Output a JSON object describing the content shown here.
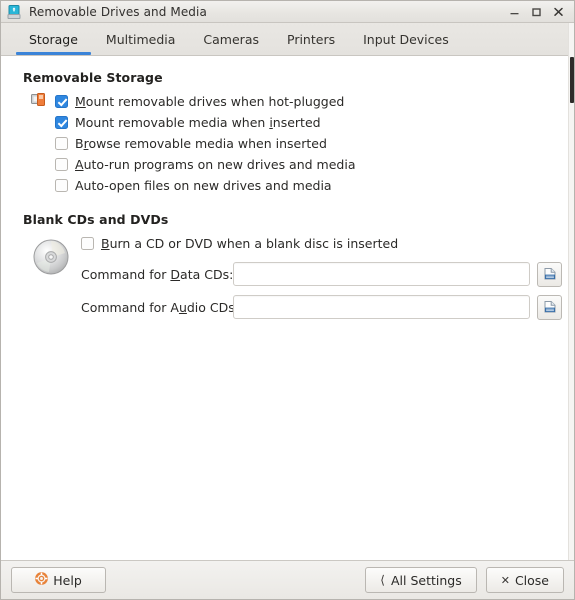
{
  "window": {
    "title": "Removable Drives and Media",
    "icon": "removable-drive-icon",
    "controls": {
      "minimize": "minimize-icon",
      "maximize": "maximize-icon",
      "close": "close-icon"
    }
  },
  "tabs": [
    {
      "label": "Storage",
      "active": true
    },
    {
      "label": "Multimedia",
      "active": false
    },
    {
      "label": "Cameras",
      "active": false
    },
    {
      "label": "Printers",
      "active": false
    },
    {
      "label": "Input Devices",
      "active": false
    }
  ],
  "storage": {
    "heading": "Removable Storage",
    "icon": "removable-media-badge-icon",
    "options": [
      {
        "label": "Mount removable drives when hot-plugged",
        "mnemonic": "M",
        "checked": true
      },
      {
        "label": "Mount removable media when inserted",
        "mnemonic": "i",
        "checked": true
      },
      {
        "label": "Browse removable media when inserted",
        "mnemonic": "r",
        "checked": false
      },
      {
        "label": "Auto-run programs on new drives and media",
        "mnemonic": "A",
        "checked": false
      },
      {
        "label": "Auto-open files on new drives and media",
        "mnemonic": "",
        "checked": false
      }
    ]
  },
  "blank_cds": {
    "heading": "Blank CDs and DVDs",
    "icon": "cd-disc-icon",
    "burn_option": {
      "label": "Burn a CD or DVD when a blank disc is inserted",
      "mnemonic": "B",
      "checked": false
    },
    "fields": [
      {
        "label": "Command for Data CDs:",
        "mnemonic": "D",
        "value": "",
        "placeholder": "",
        "browse_icon": "file-open-icon"
      },
      {
        "label": "Command for Audio CDs:",
        "mnemonic": "u",
        "value": "",
        "placeholder": "",
        "browse_icon": "file-open-icon"
      }
    ]
  },
  "footer": {
    "help_label": "Help",
    "help_icon": "help-lifering-icon",
    "all_settings_label": "All Settings",
    "all_settings_icon": "chevron-left-icon",
    "close_label": "Close",
    "close_icon": "x-icon"
  },
  "colors": {
    "accent": "#3b84d8",
    "checkbox_checked": "#2f87e0",
    "help_icon": "#e8833a",
    "window_bg": "#ffffff",
    "chrome_bg": "#e8e6e2"
  }
}
